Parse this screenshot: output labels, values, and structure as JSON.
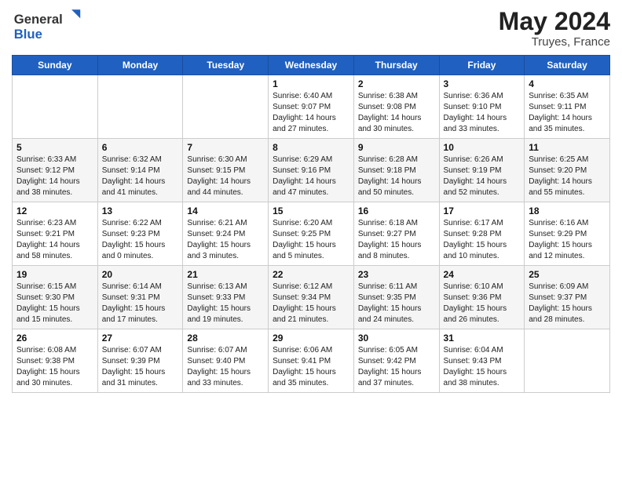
{
  "header": {
    "logo_general": "General",
    "logo_blue": "Blue",
    "month_year": "May 2024",
    "location": "Truyes, France"
  },
  "days_of_week": [
    "Sunday",
    "Monday",
    "Tuesday",
    "Wednesday",
    "Thursday",
    "Friday",
    "Saturday"
  ],
  "weeks": [
    [
      {
        "day": "",
        "info": ""
      },
      {
        "day": "",
        "info": ""
      },
      {
        "day": "",
        "info": ""
      },
      {
        "day": "1",
        "info": "Sunrise: 6:40 AM\nSunset: 9:07 PM\nDaylight: 14 hours\nand 27 minutes."
      },
      {
        "day": "2",
        "info": "Sunrise: 6:38 AM\nSunset: 9:08 PM\nDaylight: 14 hours\nand 30 minutes."
      },
      {
        "day": "3",
        "info": "Sunrise: 6:36 AM\nSunset: 9:10 PM\nDaylight: 14 hours\nand 33 minutes."
      },
      {
        "day": "4",
        "info": "Sunrise: 6:35 AM\nSunset: 9:11 PM\nDaylight: 14 hours\nand 35 minutes."
      }
    ],
    [
      {
        "day": "5",
        "info": "Sunrise: 6:33 AM\nSunset: 9:12 PM\nDaylight: 14 hours\nand 38 minutes."
      },
      {
        "day": "6",
        "info": "Sunrise: 6:32 AM\nSunset: 9:14 PM\nDaylight: 14 hours\nand 41 minutes."
      },
      {
        "day": "7",
        "info": "Sunrise: 6:30 AM\nSunset: 9:15 PM\nDaylight: 14 hours\nand 44 minutes."
      },
      {
        "day": "8",
        "info": "Sunrise: 6:29 AM\nSunset: 9:16 PM\nDaylight: 14 hours\nand 47 minutes."
      },
      {
        "day": "9",
        "info": "Sunrise: 6:28 AM\nSunset: 9:18 PM\nDaylight: 14 hours\nand 50 minutes."
      },
      {
        "day": "10",
        "info": "Sunrise: 6:26 AM\nSunset: 9:19 PM\nDaylight: 14 hours\nand 52 minutes."
      },
      {
        "day": "11",
        "info": "Sunrise: 6:25 AM\nSunset: 9:20 PM\nDaylight: 14 hours\nand 55 minutes."
      }
    ],
    [
      {
        "day": "12",
        "info": "Sunrise: 6:23 AM\nSunset: 9:21 PM\nDaylight: 14 hours\nand 58 minutes."
      },
      {
        "day": "13",
        "info": "Sunrise: 6:22 AM\nSunset: 9:23 PM\nDaylight: 15 hours\nand 0 minutes."
      },
      {
        "day": "14",
        "info": "Sunrise: 6:21 AM\nSunset: 9:24 PM\nDaylight: 15 hours\nand 3 minutes."
      },
      {
        "day": "15",
        "info": "Sunrise: 6:20 AM\nSunset: 9:25 PM\nDaylight: 15 hours\nand 5 minutes."
      },
      {
        "day": "16",
        "info": "Sunrise: 6:18 AM\nSunset: 9:27 PM\nDaylight: 15 hours\nand 8 minutes."
      },
      {
        "day": "17",
        "info": "Sunrise: 6:17 AM\nSunset: 9:28 PM\nDaylight: 15 hours\nand 10 minutes."
      },
      {
        "day": "18",
        "info": "Sunrise: 6:16 AM\nSunset: 9:29 PM\nDaylight: 15 hours\nand 12 minutes."
      }
    ],
    [
      {
        "day": "19",
        "info": "Sunrise: 6:15 AM\nSunset: 9:30 PM\nDaylight: 15 hours\nand 15 minutes."
      },
      {
        "day": "20",
        "info": "Sunrise: 6:14 AM\nSunset: 9:31 PM\nDaylight: 15 hours\nand 17 minutes."
      },
      {
        "day": "21",
        "info": "Sunrise: 6:13 AM\nSunset: 9:33 PM\nDaylight: 15 hours\nand 19 minutes."
      },
      {
        "day": "22",
        "info": "Sunrise: 6:12 AM\nSunset: 9:34 PM\nDaylight: 15 hours\nand 21 minutes."
      },
      {
        "day": "23",
        "info": "Sunrise: 6:11 AM\nSunset: 9:35 PM\nDaylight: 15 hours\nand 24 minutes."
      },
      {
        "day": "24",
        "info": "Sunrise: 6:10 AM\nSunset: 9:36 PM\nDaylight: 15 hours\nand 26 minutes."
      },
      {
        "day": "25",
        "info": "Sunrise: 6:09 AM\nSunset: 9:37 PM\nDaylight: 15 hours\nand 28 minutes."
      }
    ],
    [
      {
        "day": "26",
        "info": "Sunrise: 6:08 AM\nSunset: 9:38 PM\nDaylight: 15 hours\nand 30 minutes."
      },
      {
        "day": "27",
        "info": "Sunrise: 6:07 AM\nSunset: 9:39 PM\nDaylight: 15 hours\nand 31 minutes."
      },
      {
        "day": "28",
        "info": "Sunrise: 6:07 AM\nSunset: 9:40 PM\nDaylight: 15 hours\nand 33 minutes."
      },
      {
        "day": "29",
        "info": "Sunrise: 6:06 AM\nSunset: 9:41 PM\nDaylight: 15 hours\nand 35 minutes."
      },
      {
        "day": "30",
        "info": "Sunrise: 6:05 AM\nSunset: 9:42 PM\nDaylight: 15 hours\nand 37 minutes."
      },
      {
        "day": "31",
        "info": "Sunrise: 6:04 AM\nSunset: 9:43 PM\nDaylight: 15 hours\nand 38 minutes."
      },
      {
        "day": "",
        "info": ""
      }
    ]
  ]
}
